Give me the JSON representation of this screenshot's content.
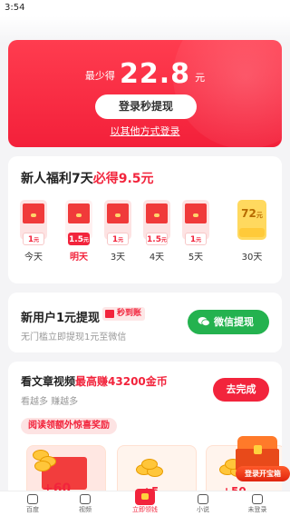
{
  "status_bar": {
    "time": "3:54"
  },
  "hero": {
    "prefix": "最少得",
    "amount": "22.8",
    "unit": "元",
    "login_button": "登录秒提现",
    "alt_login": "以其他方式登录",
    "colors": {
      "start": "#ff3c4f",
      "end": "#f3203a"
    }
  },
  "welfare": {
    "title_prefix": "新人福利7天",
    "title_highlight": "必得9.5元",
    "days": [
      {
        "amount": "1",
        "unit": "元",
        "label": "今天",
        "active": false
      },
      {
        "amount": "1.5",
        "unit": "元",
        "label": "明天",
        "active": true
      },
      {
        "amount": "1",
        "unit": "元",
        "label": "3天",
        "active": false
      },
      {
        "amount": "1.5",
        "unit": "元",
        "label": "4天",
        "active": false
      },
      {
        "amount": "1",
        "unit": "元",
        "label": "5天",
        "active": false
      },
      {
        "amount": "72",
        "unit": "元",
        "label": "30天",
        "active": false,
        "gold": true
      }
    ]
  },
  "new_user": {
    "title": "新用户1元提现",
    "badge": "秒到账",
    "subtitle": "无门槛立即提现1元至微信",
    "wechat_button": "微信提现"
  },
  "article": {
    "title_prefix": "看文章视频",
    "title_highlight": "最高赚43200金币",
    "subtitle": "看越多 赚越多",
    "finish_button": "去完成",
    "reward_strip": "阅读领额外惊喜奖励",
    "reward_values": [
      "+60",
      "+5",
      "+50"
    ],
    "chest_button": "登录开宝箱"
  },
  "bottom_nav": [
    {
      "label": "百度",
      "icon": "baidu-icon"
    },
    {
      "label": "视频",
      "icon": "video-icon"
    },
    {
      "label": "立即领钱",
      "icon": "red-envelope-icon",
      "active": true
    },
    {
      "label": "小说",
      "icon": "novel-icon"
    },
    {
      "label": "未登录",
      "icon": "profile-icon"
    }
  ],
  "accent": "#f2243c",
  "wechat_green": "#24b24f"
}
